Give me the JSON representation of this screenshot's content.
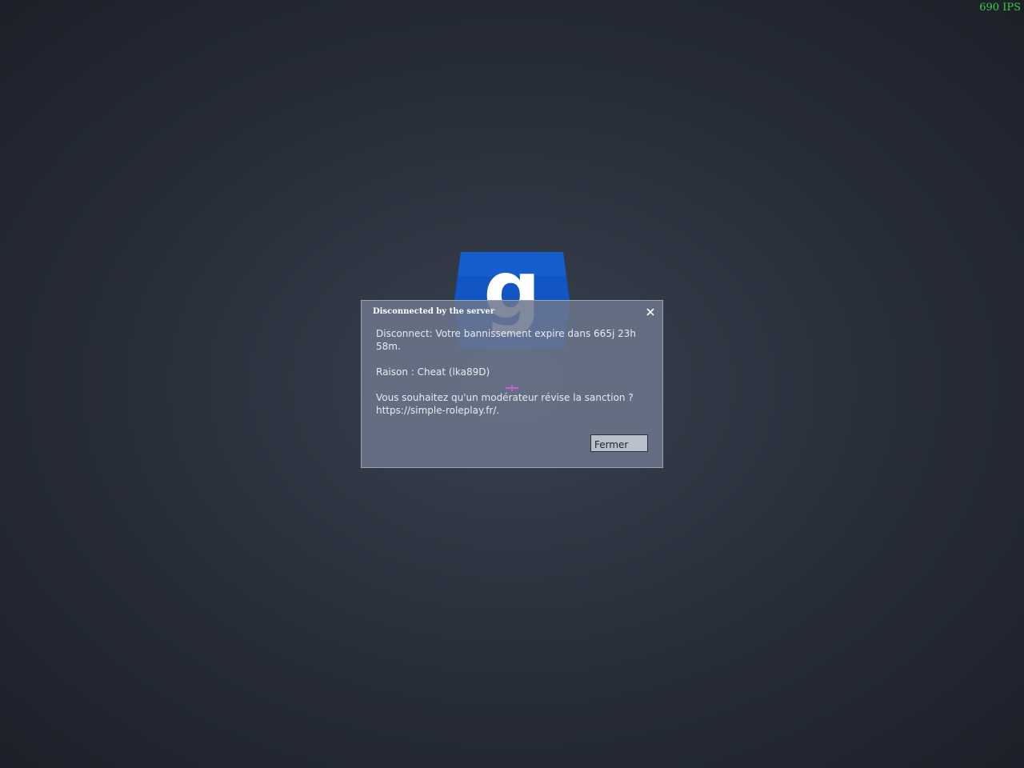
{
  "hud": {
    "fps_counter": "690 IPS"
  },
  "logo": {
    "letter": "g",
    "color": "#1256c4"
  },
  "dialog": {
    "title": "Disconnected by the server",
    "close_icon": "close-icon",
    "message": {
      "line1": "Disconnect: Votre bannissement expire dans 665j 23h 58m.",
      "line2": "Raison : Cheat (lka89D)",
      "line3": "Vous souhaitez qu'un modérateur révise la sanction ? https://simple-roleplay.fr/."
    },
    "button_label": "Fermer"
  },
  "colors": {
    "fps_green": "#39d13c",
    "dialog_bg": "#6c768c",
    "button_bg": "#b9c0cc"
  }
}
